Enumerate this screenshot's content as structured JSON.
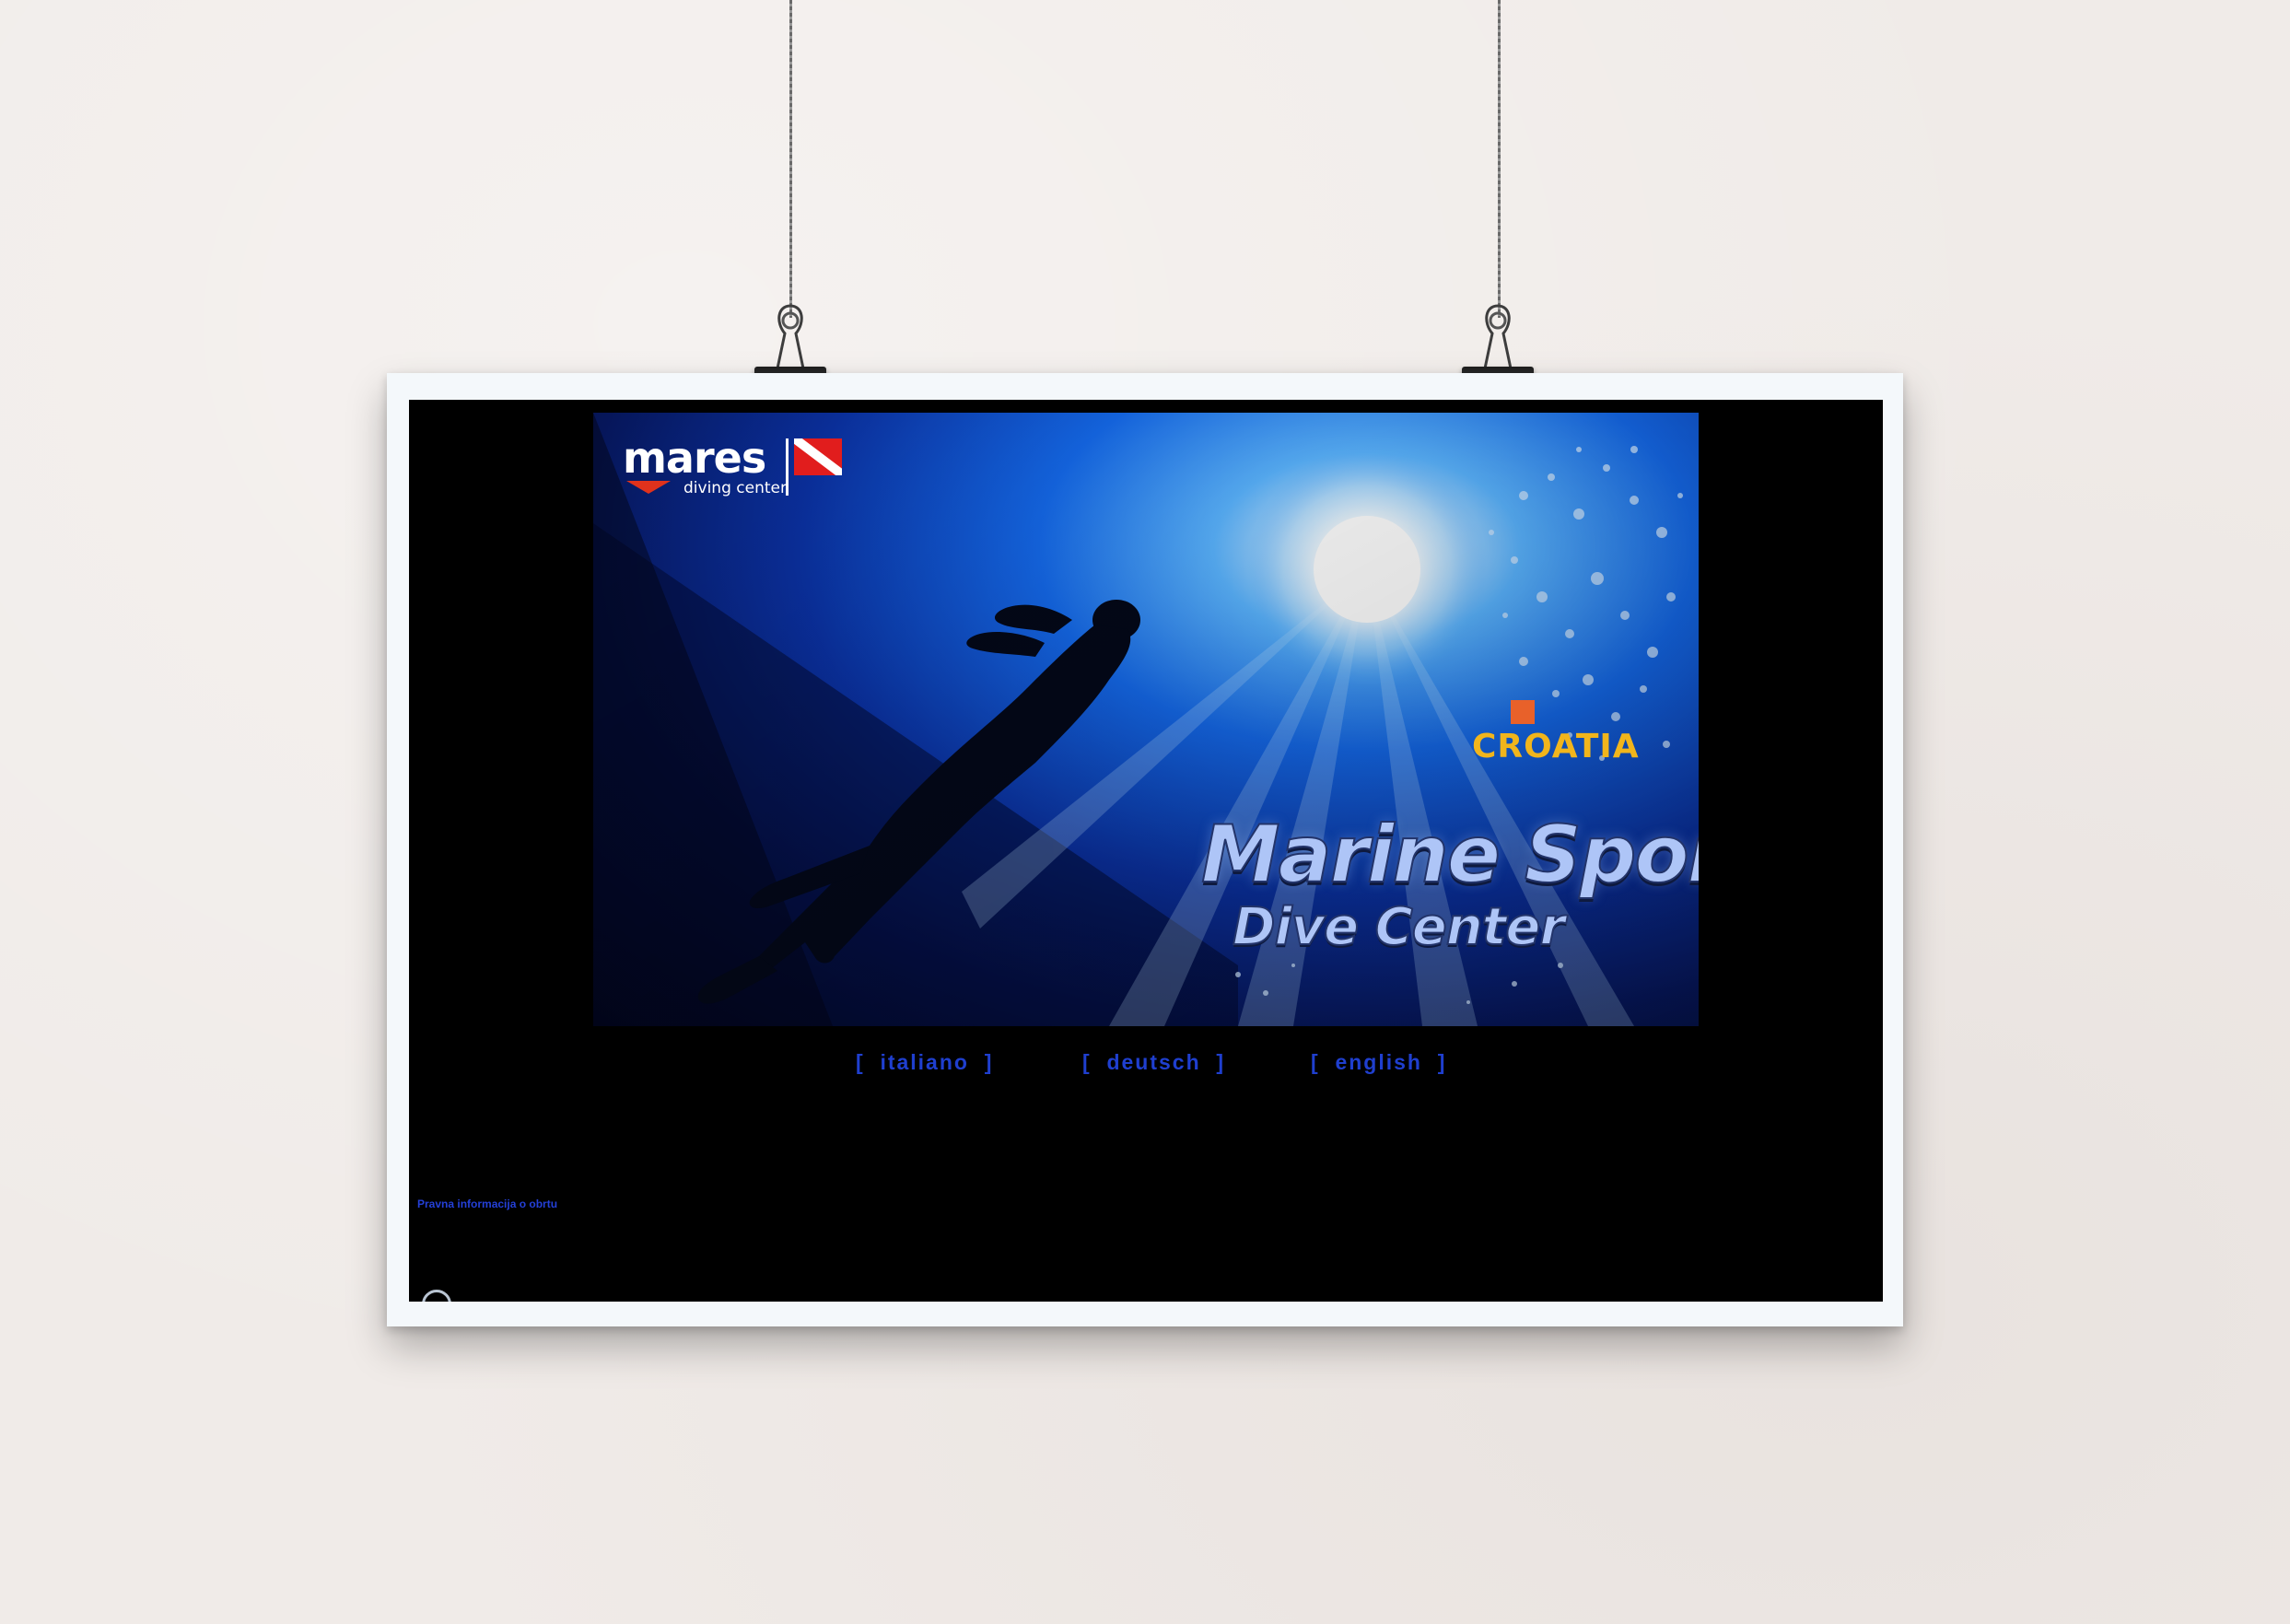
{
  "page": {
    "wall_color": "#f0ebe8",
    "frame_color": "#f4f8fb",
    "screen_background": "#000000"
  },
  "hero": {
    "brand": {
      "name": "mares",
      "subtitle": "diving center",
      "arrow_color": "#e0321c",
      "flag_color": "#e11d1d"
    },
    "croatia_logo": "CROATIA",
    "title": "Marine Sport",
    "subtitle": "Dive Center",
    "scene": "diver-silhouette-underwater-sunburst"
  },
  "language_nav": {
    "items": [
      {
        "label": "[  italiano  ]"
      },
      {
        "label": "[  deutsch  ]"
      },
      {
        "label": "[  english  ]"
      }
    ],
    "link_color": "#1f3fcf"
  },
  "footer": {
    "legal_link": "Pravna informacija o obrtu",
    "link_color": "#2440d8"
  }
}
